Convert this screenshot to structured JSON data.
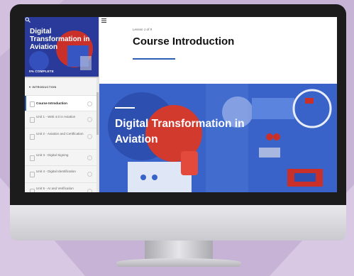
{
  "colors": {
    "background": "#c7b3d6",
    "accent": "#2c5fb3",
    "hero_blue": "#3a63c9"
  },
  "sidebar": {
    "course_title": "Digital Transformation in Aviation",
    "progress_label": "0% COMPLETE",
    "section_label": "INTRODUCTION",
    "lessons": [
      {
        "label": "Course Introduction",
        "active": true
      },
      {
        "label": "Unit 1 - Web 4.0 in Aviation"
      },
      {
        "label": "Unit 2 - Aviation and Certification"
      },
      {
        "label": "Unit 3 - Digital Signing"
      },
      {
        "label": "Unit 4 - Digital Identification"
      },
      {
        "label": "Unit 5 - AI and Verification"
      }
    ]
  },
  "main": {
    "lesson_counter": "Lesson 1 of 9",
    "page_title": "Course Introduction",
    "hero_title": "Digital Transformation in Aviation"
  }
}
